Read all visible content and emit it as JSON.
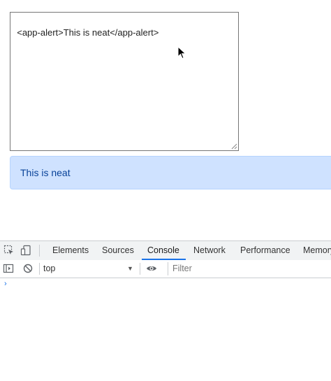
{
  "editor": {
    "content": "<app-alert>This is neat</app-alert>"
  },
  "alert": {
    "text": "This is neat"
  },
  "devtools": {
    "tabs": [
      {
        "label": "Elements"
      },
      {
        "label": "Sources"
      },
      {
        "label": "Console",
        "active": true
      },
      {
        "label": "Network"
      },
      {
        "label": "Performance"
      },
      {
        "label": "Memory"
      }
    ],
    "context": "top",
    "filter_placeholder": "Filter",
    "prompt_symbol": "›"
  },
  "colors": {
    "alert_bg": "#cfe2ff",
    "alert_text": "#084298",
    "active_tab_underline": "#1a73e8"
  }
}
